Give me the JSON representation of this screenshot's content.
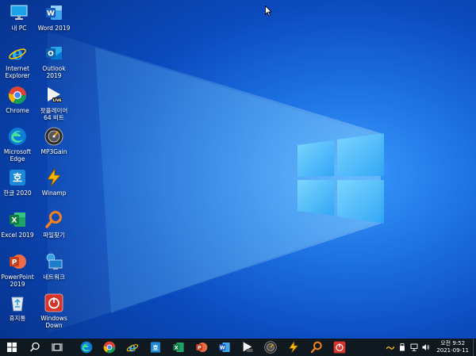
{
  "desktop_icons": [
    {
      "label": "내 PC"
    },
    {
      "label": "Word 2019"
    },
    {
      "label": "Internet\nExplorer"
    },
    {
      "label": "Outlook\n2019"
    },
    {
      "label": "Chrome"
    },
    {
      "label": "팟플레이어\n64 비트"
    },
    {
      "label": "Microsoft\nEdge"
    },
    {
      "label": "MP3Gain"
    },
    {
      "label": "한글 2020"
    },
    {
      "label": "Winamp"
    },
    {
      "label": "Excel 2019"
    },
    {
      "label": "파일찾기"
    },
    {
      "label": "PowerPoint\n2019"
    },
    {
      "label": "네트워크"
    },
    {
      "label": "휴지통"
    },
    {
      "label": "Windows\nDown"
    }
  ],
  "taskbar": {
    "clock_time": "오전 9:52",
    "clock_date": "2021-09-11",
    "pinned": [
      "edge-icon",
      "chrome-icon",
      "ie-icon",
      "hwp-tray-icon",
      "excel-icon",
      "powerpoint-icon",
      "word-icon",
      "potplayer-icon",
      "mp3gain-icon",
      "search-tool-icon",
      "power-icon"
    ]
  },
  "colors": {
    "wallpaper_light": "#3a9bff",
    "wallpaper_dark": "#073592",
    "taskbar": "#101820"
  }
}
